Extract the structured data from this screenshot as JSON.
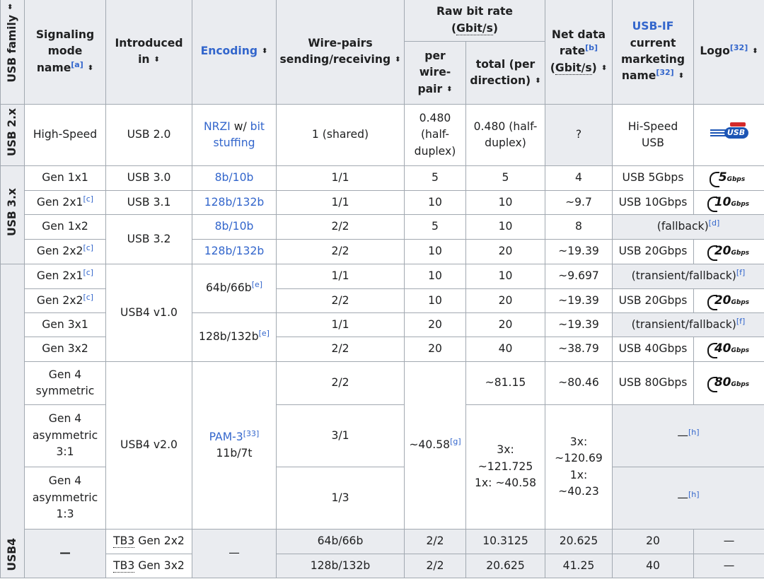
{
  "headers": {
    "family": "USB family",
    "signaling": "Signaling mode name",
    "signaling_note": "[a]",
    "introduced": "Introduced in",
    "encoding": "Encoding",
    "wirepairs": "Wire-pairs sending/receiving",
    "raw_rate_prefix": "Raw bit rate",
    "raw_rate_unit": "Gbit/s",
    "per_pair": "per wire-pair",
    "total": "total (per direction)",
    "net_prefix": "Net data rate",
    "net_note": "[b]",
    "net_unit": "Gbit/s",
    "usbif_link": "USB-IF",
    "usbif_rest": "current marketing name",
    "usbif_note": "[32]",
    "logo": "Logo",
    "logo_note": "[32]"
  },
  "sort_icon": "⬍",
  "families": {
    "usb2": "USB 2.x",
    "usb3": "USB 3.x",
    "usb4": "USB4",
    "tb": "—"
  },
  "rows": {
    "hs": {
      "mode": "High-Speed",
      "intro": "USB 2.0",
      "enc_link1": "NRZI",
      "enc_mid": " w/ ",
      "enc_link2": "bit stuffing",
      "pairs": "1 (shared)",
      "per": "0.480 (half-duplex)",
      "total": "0.480 (half-duplex)",
      "net": "?",
      "name": "Hi-Speed USB",
      "logo": "USB"
    },
    "g1x1": {
      "mode": "Gen 1x1",
      "intro": "USB 3.0",
      "enc": "8b/10b",
      "pairs": "1/1",
      "per": "5",
      "total": "5",
      "net": "4",
      "name": "USB 5Gbps",
      "logo_big": "5",
      "logo_small": "Gbps"
    },
    "g2x1a": {
      "mode": "Gen 2x1",
      "note": "[c]",
      "intro": "USB 3.1",
      "enc": "128b/132b",
      "pairs": "1/1",
      "per": "10",
      "total": "10",
      "net": "~9.7",
      "name": "USB 10Gbps",
      "logo_big": "10",
      "logo_small": "Gbps"
    },
    "g1x2": {
      "mode": "Gen 1x2",
      "intro": "USB 3.2",
      "enc": "8b/10b",
      "pairs": "2/2",
      "per": "5",
      "total": "10",
      "net": "8",
      "name": "(fallback)",
      "name_note": "[d]"
    },
    "g2x2a": {
      "mode": "Gen 2x2",
      "note": "[c]",
      "enc": "128b/132b",
      "pairs": "2/2",
      "per": "10",
      "total": "20",
      "net": "~19.39",
      "name": "USB 20Gbps",
      "logo_big": "20",
      "logo_small": "Gbps"
    },
    "g2x1b": {
      "mode": "Gen 2x1",
      "note": "[c]",
      "intro": "USB4 v1.0",
      "enc": "64b/66b",
      "enc_note": "[e]",
      "pairs": "1/1",
      "per": "10",
      "total": "10",
      "net": "~9.697",
      "name": "(transient/fallback)",
      "name_note": "[f]"
    },
    "g2x2b": {
      "mode": "Gen 2x2",
      "note": "[c]",
      "pairs": "2/2",
      "per": "10",
      "total": "20",
      "net": "~19.39",
      "name": "USB 20Gbps",
      "logo_big": "20",
      "logo_small": "Gbps"
    },
    "g3x1": {
      "mode": "Gen 3x1",
      "enc": "128b/132b",
      "enc_note": "[e]",
      "pairs": "1/1",
      "per": "20",
      "total": "20",
      "net": "~19.39",
      "name": "(transient/fallback)",
      "name_note": "[f]"
    },
    "g3x2": {
      "mode": "Gen 3x2",
      "pairs": "2/2",
      "per": "20",
      "total": "40",
      "net": "~38.79",
      "name": "USB 40Gbps",
      "logo_big": "40",
      "logo_small": "Gbps"
    },
    "g4s": {
      "mode": "Gen 4 symmetric",
      "intro": "USB4 v2.0",
      "enc_link": "PAM-3",
      "enc_note": "[33]",
      "enc2": "11b/7t",
      "pairs": "2/2",
      "per": "~40.58",
      "per_note": "[g]",
      "total": "~81.15",
      "net": "~80.46",
      "name": "USB 80Gbps",
      "logo_big": "80",
      "logo_small": "Gbps"
    },
    "g4a31": {
      "mode": "Gen 4 asymmetric 3:1",
      "pairs": "3/1",
      "total": "3x: ~121.725 1x: ~40.58",
      "net": "3x: ~120.69 1x: ~40.23",
      "name": "—",
      "name_note": "[h]"
    },
    "g4a13": {
      "mode": "Gen 4 asymmetric 1:3",
      "pairs": "1/3",
      "name": "—",
      "name_note": "[h]"
    },
    "tb1": {
      "mode_abbr": "TB3",
      "mode_rest": " Gen 2x2",
      "intro": "—",
      "enc": "64b/66b",
      "pairs": "2/2",
      "per": "10.3125",
      "total": "20.625",
      "net": "20",
      "name": "—"
    },
    "tb2": {
      "mode_abbr": "TB3",
      "mode_rest": " Gen 3x2",
      "enc": "128b/132b",
      "pairs": "2/2",
      "per": "20.625",
      "total": "41.25",
      "net": "40",
      "name": "—"
    }
  }
}
